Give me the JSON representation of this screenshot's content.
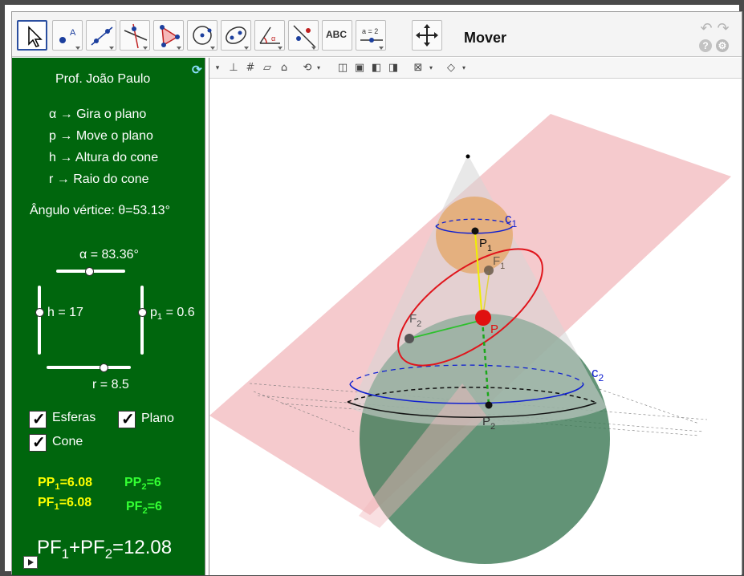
{
  "toolbar": {
    "mode_label": "Mover",
    "tools": [
      {
        "name": "move-tool",
        "icon": "cursor-arrow-icon"
      },
      {
        "name": "point-tool",
        "icon": "point-icon"
      },
      {
        "name": "line-tool",
        "icon": "line-icon"
      },
      {
        "name": "perpendicular-line-tool",
        "icon": "perpendicular-icon"
      },
      {
        "name": "polygon-tool",
        "icon": "polygon-icon"
      },
      {
        "name": "circle-tool",
        "icon": "circle-icon"
      },
      {
        "name": "ellipse-tool",
        "icon": "ellipse-icon"
      },
      {
        "name": "angle-tool",
        "icon": "angle-icon"
      },
      {
        "name": "reflect-tool",
        "icon": "reflect-icon"
      },
      {
        "name": "text-tool",
        "icon": "text-abc-icon"
      },
      {
        "name": "slider-tool",
        "icon": "slider-icon"
      },
      {
        "name": "move-view-tool",
        "icon": "move-arrows-icon"
      }
    ],
    "text_tool_label": "ABC",
    "slider_tool_label": "a = 2"
  },
  "panel": {
    "author": "Prof. João Paulo",
    "legend": [
      {
        "key": "α",
        "desc": "Gira o plano"
      },
      {
        "key": "p",
        "desc": "Move o plano"
      },
      {
        "key": "h",
        "desc": "Altura do cone"
      },
      {
        "key": "r",
        "desc": "Raio do cone"
      }
    ],
    "arrow": "→",
    "vertex_angle": "Ângulo vértice: θ=53.13°",
    "sliders": {
      "alpha": {
        "label": "α = 83.36°",
        "fraction": 0.48
      },
      "h": {
        "label": "h = 17",
        "fraction": 0.5
      },
      "p1": {
        "label_main": "p",
        "label_sub": "1",
        "label_rest": " = 0.6",
        "fraction": 0.5
      },
      "r": {
        "label": "r = 8.5",
        "fraction": 0.68
      }
    },
    "checkboxes": [
      {
        "label": "Esferas",
        "checked": true
      },
      {
        "label": "Plano",
        "checked": true
      },
      {
        "label": "Cone",
        "checked": true
      }
    ],
    "measures": {
      "pp1": {
        "a": "PP",
        "sub": "1",
        "b": "=6.08"
      },
      "pf1": {
        "a": "PF",
        "sub": "1",
        "b": "=6.08"
      },
      "pp2": {
        "a": "PP",
        "sub": "2",
        "b": "=6"
      },
      "pf2": {
        "a": "PF",
        "sub": "2",
        "b": "=6"
      }
    },
    "sum": {
      "a": "PF",
      "s1": "1",
      "b": "+PF",
      "s2": "2",
      "c": "=12.08"
    }
  },
  "scene_labels": {
    "c1": "c",
    "c1_sub": "1",
    "c2": "c",
    "c2_sub": "2",
    "P": "P",
    "P1": "P",
    "P1_sub": "1",
    "P2": "P",
    "P2_sub": "2",
    "F1": "F",
    "F1_sub": "1",
    "F2": "F",
    "F2_sub": "2"
  },
  "colors": {
    "panel_bg": "#00660d",
    "plane": "#f2b8bc",
    "small_sphere": "#e4a86a",
    "large_sphere": "#3f7b58",
    "ellipse": "#e0151c",
    "circle": "#1020d0",
    "yellow": "#ffff00",
    "green": "#33ff33"
  }
}
